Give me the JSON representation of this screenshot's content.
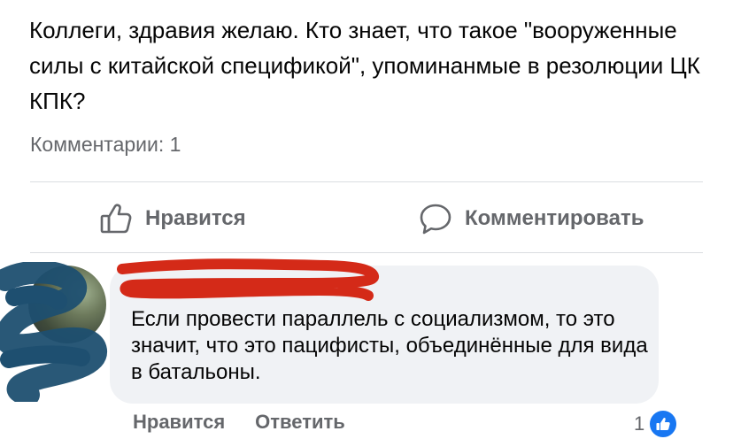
{
  "post": {
    "text": "Коллеги, здравия желаю. Кто знает, что такое \"вооруженные силы с китайской спецификой\", упоминанмые в резолюции ЦК КПК?",
    "comments_count_label": "Комментарии: 1"
  },
  "actions": {
    "like_label": "Нравится",
    "comment_label": "Комментировать",
    "like_icon": "thumbs-up-outline-icon",
    "comment_icon": "speech-bubble-icon"
  },
  "comment": {
    "author": "",
    "text": "Если провести параллель с социализмом, то это значит, что это пацифисты, объединённые для вида в батальоны.",
    "like_label": "Нравится",
    "reply_label": "Ответить",
    "reactions_count": "1",
    "reaction_icon": "like-reaction-icon"
  },
  "colors": {
    "secondary_text": "#65676b",
    "bubble_bg": "#f0f2f5",
    "accent": "#1877f2",
    "redaction_red": "#d42a18",
    "redaction_blue": "#1e4f70"
  }
}
